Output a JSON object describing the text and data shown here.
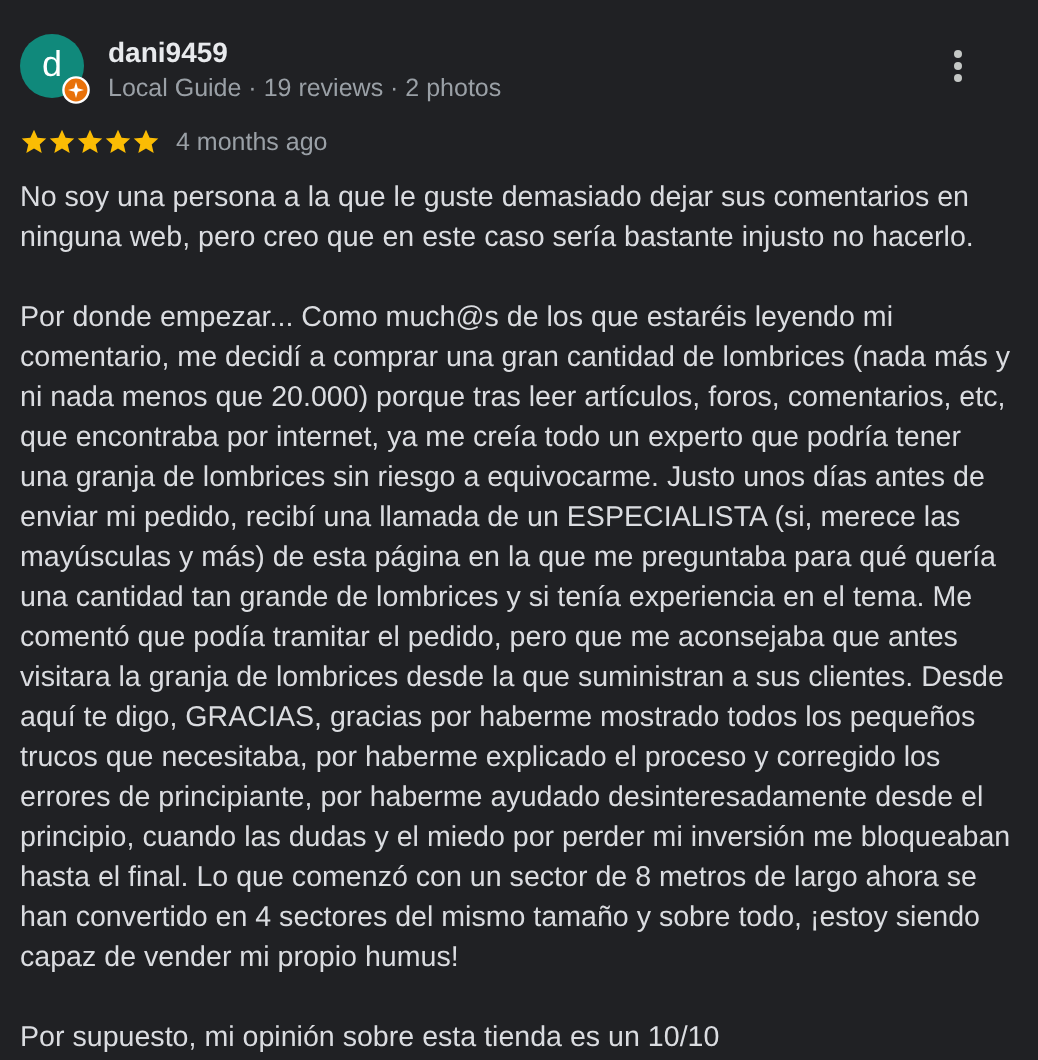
{
  "review": {
    "avatar_letter": "d",
    "local_guide": true,
    "author": "dani9459",
    "meta": "Local Guide · 19 reviews · 2 photos",
    "stars": 5,
    "time": "4 months ago",
    "paragraphs": [
      "No soy una persona a la que le guste demasiado dejar sus comentarios en ninguna web, pero creo que en este caso sería bastante injusto no hacerlo.",
      "Por donde empezar... Como much@s de los que estaréis leyendo mi comentario, me decidí a comprar una gran cantidad de lombrices (nada más y ni nada menos que 20.000) porque tras leer artículos, foros, comentarios, etc, que encontraba por internet, ya me creía todo un experto que podría tener una granja de lombrices sin riesgo a equivocarme. Justo unos días antes de enviar mi pedido, recibí una llamada de un ESPECIALISTA (si, merece las mayúsculas y más) de esta página en la que me preguntaba para qué quería una cantidad tan grande de lombrices y si tenía experiencia en el tema. Me comentó que podía tramitar el pedido, pero que me aconsejaba que antes visitara la granja de lombrices desde la que suministran a sus clientes. Desde aquí te digo, GRACIAS, gracias por haberme mostrado todos los pequeños trucos que necesitaba, por haberme explicado el proceso y corregido los errores de principiante, por haberme ayudado desinteresadamente desde el principio, cuando las dudas y el miedo por perder mi inversión me bloqueaban hasta el final. Lo que comenzó con un sector de 8 metros de largo ahora se han convertido en 4 sectores del mismo tamaño y sobre todo, ¡estoy siendo capaz de vender mi propio humus!",
      "Por supuesto, mi opinión sobre esta tienda es un 10/10"
    ]
  }
}
